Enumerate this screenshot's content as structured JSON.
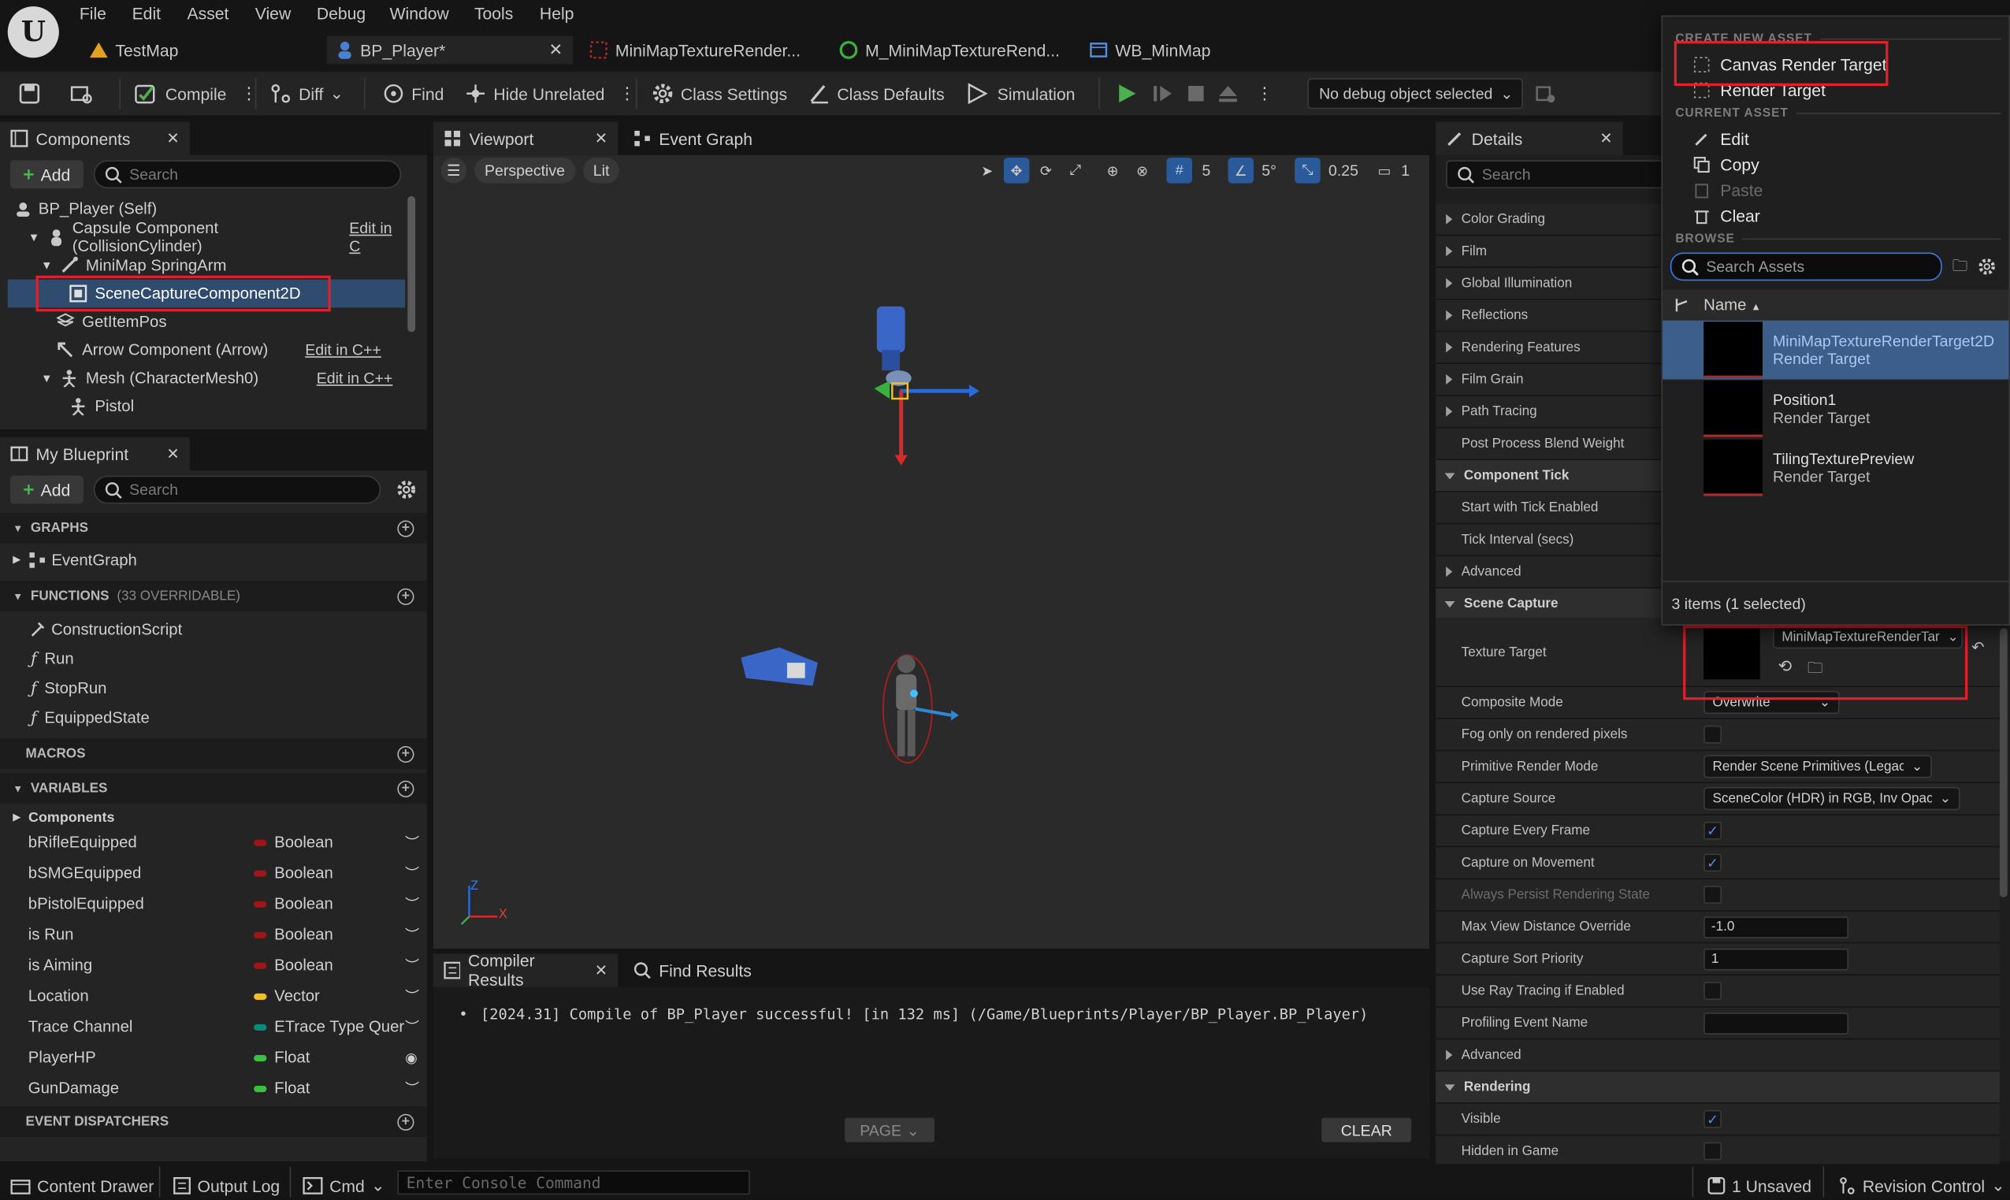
{
  "menu": [
    "File",
    "Edit",
    "Asset",
    "View",
    "Debug",
    "Window",
    "Tools",
    "Help"
  ],
  "doc_tabs": [
    {
      "label": "TestMap",
      "icon": "level-icon"
    },
    {
      "label": "BP_Player*",
      "icon": "blueprint-icon"
    },
    {
      "label": "MiniMapTextureRender...",
      "icon": "render-target-icon"
    },
    {
      "label": "M_MiniMapTextureRend...",
      "icon": "material-icon"
    },
    {
      "label": "WB_MinMap",
      "icon": "widget-icon"
    }
  ],
  "toolbar": {
    "compile": "Compile",
    "diff": "Diff",
    "find": "Find",
    "hide_unrelated": "Hide Unrelated",
    "class_settings": "Class Settings",
    "class_defaults": "Class Defaults",
    "simulation": "Simulation",
    "debug_object": "No debug object selected"
  },
  "components": {
    "tab": "Components",
    "add": "Add",
    "search_placeholder": "Search",
    "rows": [
      {
        "label": "BP_Player (Self)",
        "indent": 0
      },
      {
        "label": "Capsule Component (CollisionCylinder)",
        "edit": "Edit in C",
        "indent": 1
      },
      {
        "label": "MiniMap SpringArm",
        "indent": 2
      },
      {
        "label": "SceneCaptureComponent2D",
        "indent": 3,
        "selected": true
      },
      {
        "label": "GetItemPos",
        "indent": 2
      },
      {
        "label": "Arrow Component (Arrow)",
        "edit": "Edit in C++",
        "indent": 2
      },
      {
        "label": "Mesh (CharacterMesh0)",
        "edit": "Edit in C++",
        "indent": 2
      },
      {
        "label": "Pistol",
        "indent": 3
      }
    ]
  },
  "my_blueprint": {
    "tab": "My Blueprint",
    "add": "Add",
    "search_placeholder": "Search",
    "graphs": "GRAPHS",
    "graph_items": [
      "EventGraph"
    ],
    "functions": "FUNCTIONS",
    "functions_sub": "(33 OVERRIDABLE)",
    "function_items": [
      "ConstructionScript",
      "Run",
      "StopRun",
      "EquippedState"
    ],
    "macros": "MACROS",
    "variables": "VARIABLES",
    "var_category": "Components",
    "variables_list": [
      {
        "name": "bRifleEquipped",
        "type": "Boolean",
        "color": "#a01515"
      },
      {
        "name": "bSMGEquipped",
        "type": "Boolean",
        "color": "#a01515"
      },
      {
        "name": "bPistolEquipped",
        "type": "Boolean",
        "color": "#a01515"
      },
      {
        "name": "is Run",
        "type": "Boolean",
        "color": "#a01515"
      },
      {
        "name": "is Aiming",
        "type": "Boolean",
        "color": "#a01515"
      },
      {
        "name": "Location",
        "type": "Vector",
        "color": "#f0c020"
      },
      {
        "name": "Trace Channel",
        "type": "ETrace Type Quer",
        "color": "#0a8a7a"
      },
      {
        "name": "PlayerHP",
        "type": "Float",
        "color": "#3ac040"
      },
      {
        "name": "GunDamage",
        "type": "Float",
        "color": "#3ac040"
      }
    ],
    "event_dispatchers": "EVENT DISPATCHERS"
  },
  "viewport": {
    "tab": "Viewport",
    "tab2": "Event Graph",
    "perspective": "Perspective",
    "lit": "Lit",
    "grid_snap": "5",
    "rot_snap": "5°",
    "scale_snap": "0.25",
    "camera_speed": "1",
    "axis_x": "X",
    "axis_z": "Z"
  },
  "compiler": {
    "tab": "Compiler Results",
    "tab2": "Find Results",
    "message": "[2024.31] Compile of BP_Player successful! [in 132 ms] (/Game/Blueprints/Player/BP_Player.BP_Player)",
    "page": "PAGE",
    "clear": "CLEAR"
  },
  "details": {
    "tab": "Details",
    "search_placeholder": "Search",
    "rows": [
      {
        "kind": "cat",
        "label": "Color Grading"
      },
      {
        "kind": "cat",
        "label": "Film"
      },
      {
        "kind": "cat",
        "label": "Global Illumination"
      },
      {
        "kind": "cat",
        "label": "Reflections"
      },
      {
        "kind": "cat",
        "label": "Rendering Features"
      },
      {
        "kind": "cat",
        "label": "Film Grain"
      },
      {
        "kind": "cat",
        "label": "Path Tracing"
      },
      {
        "kind": "prop",
        "label": "Post Process Blend Weight"
      },
      {
        "kind": "hdr",
        "label": "Component Tick"
      },
      {
        "kind": "prop",
        "label": "Start with Tick Enabled"
      },
      {
        "kind": "prop",
        "label": "Tick Interval (secs)"
      },
      {
        "kind": "cat",
        "label": "Advanced"
      },
      {
        "kind": "hdr",
        "label": "Scene Capture"
      }
    ],
    "texture_target_label": "Texture Target",
    "texture_target_value": "MiniMapTextureRenderTar",
    "props": [
      {
        "label": "Composite Mode",
        "type": "combo",
        "value": "Overwrite"
      },
      {
        "label": "Fog only on rendered pixels",
        "type": "check",
        "checked": false
      },
      {
        "label": "Primitive Render Mode",
        "type": "combo",
        "value": "Render Scene Primitives (Legacy)"
      },
      {
        "label": "Capture Source",
        "type": "combo",
        "value": "SceneColor (HDR) in RGB, Inv Opacity i"
      },
      {
        "label": "Capture Every Frame",
        "type": "check",
        "checked": true
      },
      {
        "label": "Capture on Movement",
        "type": "check",
        "checked": true
      },
      {
        "label": "Always Persist Rendering State",
        "type": "check",
        "checked": false,
        "dim": true
      },
      {
        "label": "Max View Distance Override",
        "type": "num",
        "value": "-1.0"
      },
      {
        "label": "Capture Sort Priority",
        "type": "num",
        "value": "1"
      },
      {
        "label": "Use Ray Tracing if Enabled",
        "type": "check",
        "checked": false
      },
      {
        "label": "Profiling Event Name",
        "type": "num",
        "value": ""
      },
      {
        "label": "Advanced",
        "type": "cat"
      },
      {
        "label": "Rendering",
        "type": "hdr"
      },
      {
        "label": "Visible",
        "type": "check",
        "checked": true
      },
      {
        "label": "Hidden in Game",
        "type": "check",
        "checked": false
      }
    ]
  },
  "popup": {
    "create_new_asset": "CREATE NEW ASSET",
    "canvas_render_target": "Canvas Render Target",
    "render_target": "Render Target",
    "current_asset": "CURRENT ASSET",
    "edit": "Edit",
    "copy": "Copy",
    "paste": "Paste",
    "clear": "Clear",
    "browse": "BROWSE",
    "search_placeholder": "Search Assets",
    "name_col": "Name",
    "assets": [
      {
        "name": "MiniMapTextureRenderTarget2D",
        "type": "Render Target",
        "selected": true
      },
      {
        "name": "Position1",
        "type": "Render Target"
      },
      {
        "name": "TilingTexturePreview",
        "type": "Render Target"
      }
    ],
    "count": "3 items (1 selected)"
  },
  "statusbar": {
    "content_drawer": "Content Drawer",
    "output_log": "Output Log",
    "cmd": "Cmd",
    "console_placeholder": "Enter Console Command",
    "unsaved": "1 Unsaved",
    "revision_control": "Revision Control"
  }
}
